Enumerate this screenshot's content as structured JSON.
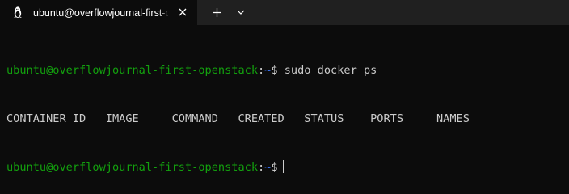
{
  "window": {
    "tab": {
      "title": "ubuntu@overflowjournal-first-openstack",
      "icon": "linux-tux-icon",
      "close_icon": "close-icon"
    },
    "new_tab_icon": "plus-icon",
    "dropdown_icon": "chevron-down-icon"
  },
  "terminal": {
    "lines": [
      {
        "user_host": "ubuntu@overflowjournal-first-openstack",
        "sep": ":",
        "path": "~",
        "prompt": "$",
        "command": " sudo docker ps"
      },
      {
        "output": "CONTAINER ID   IMAGE     COMMAND   CREATED   STATUS    PORTS     NAMES"
      },
      {
        "user_host": "ubuntu@overflowjournal-first-openstack",
        "sep": ":",
        "path": "~",
        "prompt": "$"
      }
    ]
  },
  "colors": {
    "background": "#0c0c0c",
    "tabbar": "#202020",
    "prompt_green": "#13a10e",
    "path_blue": "#3b78ff",
    "text": "#cccccc"
  }
}
